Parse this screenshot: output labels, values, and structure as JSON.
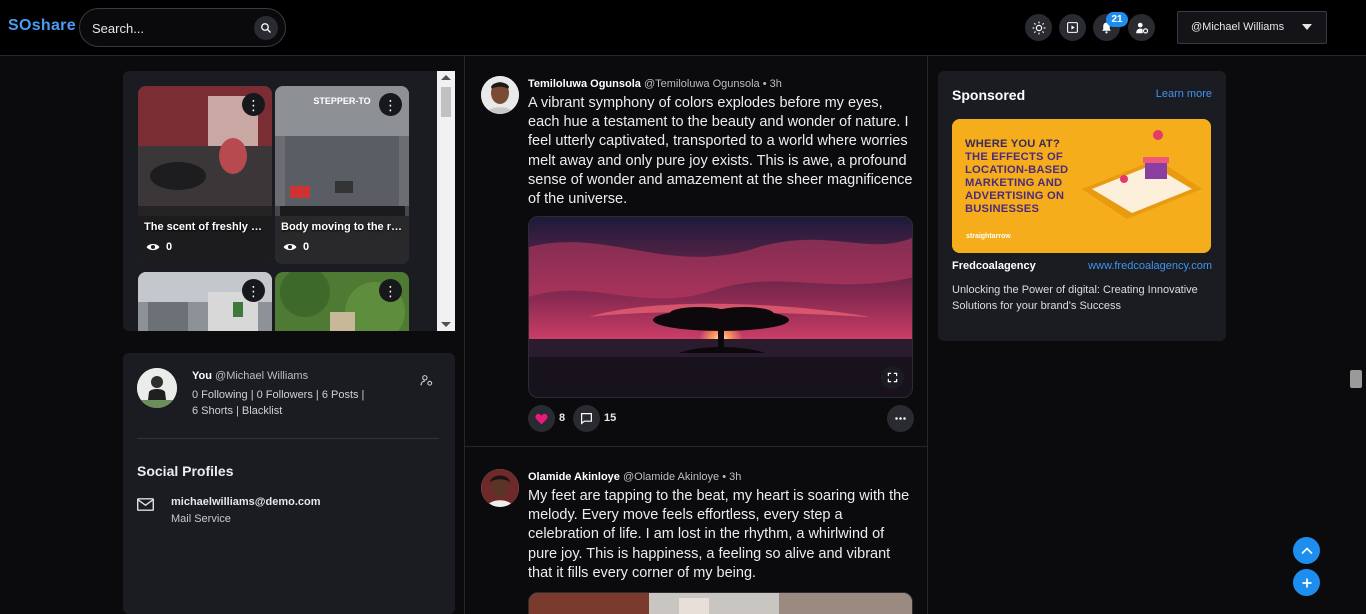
{
  "header": {
    "logo": "SOshare",
    "search_placeholder": "Search...",
    "notifications_count": "21",
    "user_handle": "@Michael Williams"
  },
  "shorts": [
    {
      "title": "The scent of freshly baked...",
      "views": "0"
    },
    {
      "title": "Body moving to the rhythm...",
      "views": "0"
    },
    {
      "title": "",
      "views": ""
    },
    {
      "title": "",
      "views": ""
    }
  ],
  "profile": {
    "name": "You",
    "handle": "@Michael Williams",
    "stats_line1": "0 Following | 0 Followers | 6 Posts |",
    "stats_line2": "6 Shorts | Blacklist",
    "social_title": "Social Profiles",
    "email": "michaelwilliams@demo.com",
    "email_service": "Mail Service"
  },
  "posts": [
    {
      "author": "Temiloluwa Ogunsola",
      "handle": "@Temiloluwa Ogunsola",
      "time": "• 3h",
      "text": "A vibrant symphony of colors explodes before my eyes, each hue a testament to the beauty and wonder of nature. I feel utterly captivated, transported to a world where worries melt away and only pure joy exists. This is awe, a profound sense of wonder and amazement at the sheer magnificence of the universe.",
      "likes": "8",
      "comments": "15"
    },
    {
      "author": "Olamide Akinloye",
      "handle": "@Olamide Akinloye",
      "time": "• 3h",
      "text": "My feet are tapping to the beat, my heart is soaring with the melody. Every move feels effortless, every step a celebration of life. I am lost in the rhythm, a whirlwind of pure joy. This is happiness, a feeling so alive and vibrant that it fills every corner of my being."
    }
  ],
  "sponsored": {
    "title": "Sponsored",
    "learn_more": "Learn more",
    "ad_lines": [
      "WHERE YOU AT?",
      "THE EFFECTS OF",
      "LOCATION-BASED",
      "MARKETING AND",
      "ADVERTISING ON",
      "BUSINESSES"
    ],
    "ad_brand": "straightarrow",
    "advertiser": "Fredcoalagency",
    "url": "www.fredcoalagency.com",
    "description": "Unlocking the Power of digital: Creating Innovative Solutions for your brand's Success"
  },
  "colors": {
    "accent": "#1d8ef0",
    "link": "#3d95f0",
    "panel": "#1b1c21",
    "heart": "#e8197d"
  }
}
